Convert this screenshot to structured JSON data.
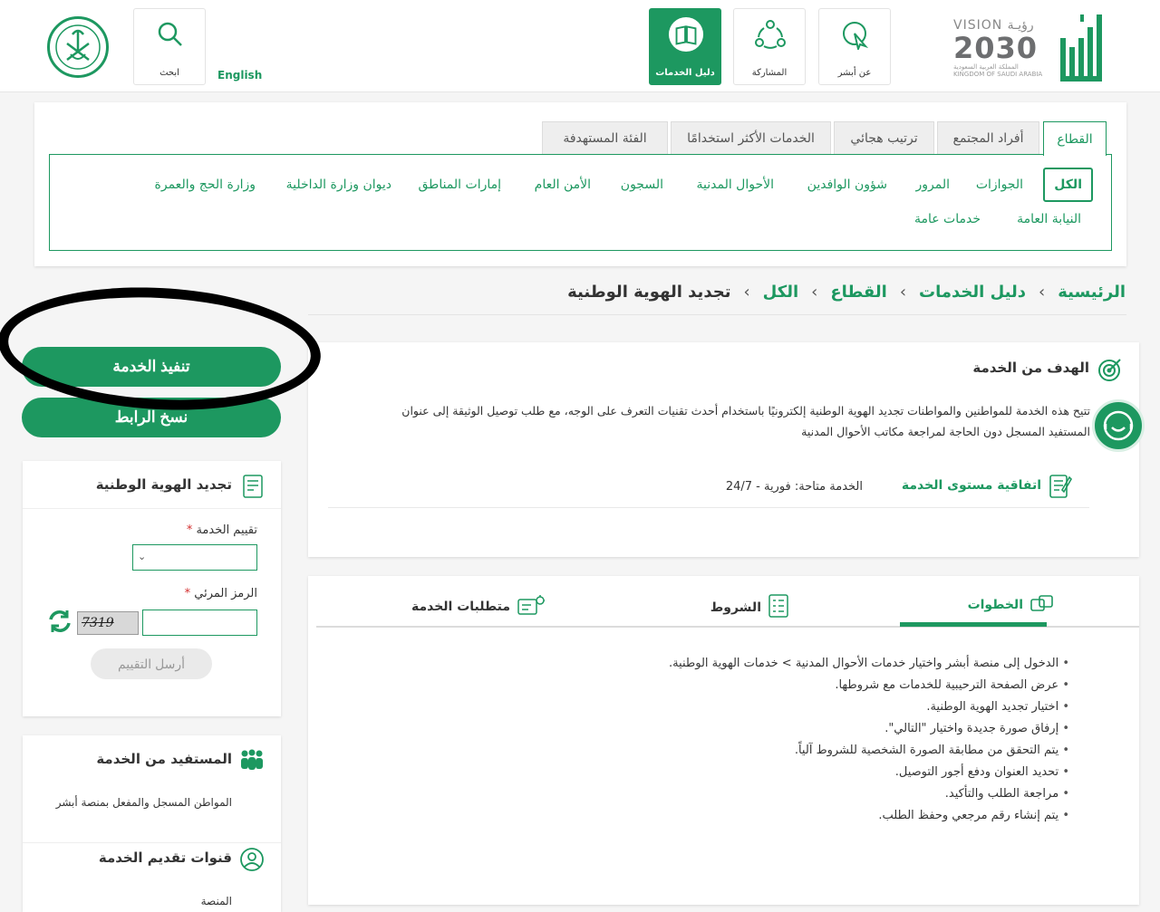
{
  "header": {
    "vision_line1": "VISION رؤيـة",
    "vision_year": "2030",
    "vision_country": "المملكة العربية السعودية KINGDOM OF SAUDI ARABIA",
    "nav": [
      {
        "label": "عن أبشر",
        "icon": "pointer-icon"
      },
      {
        "label": "المشاركة",
        "icon": "community-icon"
      },
      {
        "label": "دليل الخدمات",
        "icon": "book-icon"
      }
    ],
    "english_label": "English",
    "search_label": "ابحث"
  },
  "sector": {
    "tabs": [
      "القطاع",
      "أفراد المجتمع",
      "ترتيب هجائي",
      "الخدمات الأكثر استخدامًا",
      "الفئة المستهدفة"
    ],
    "filters_row1": [
      "الكل",
      "الجوازات",
      "المرور",
      "شؤون الوافدين",
      "الأحوال المدنية",
      "السجون",
      "الأمن العام",
      "إمارات المناطق",
      "ديوان وزارة الداخلية",
      "وزارة الحج والعمرة"
    ],
    "filters_row2": [
      "النيابة العامة",
      "خدمات عامة"
    ]
  },
  "breadcrumb": [
    "الرئيسية",
    "دليل الخدمات",
    "القطاع",
    "الكل",
    "تجديد الهوية الوطنية"
  ],
  "sidebar": {
    "execute_label": "تنفيذ الخدمة",
    "copy_link_label": "نسخ الرابط",
    "rating_card_title": "تجديد الهوية الوطنية",
    "rating_label": "تقييم الخدمة",
    "captcha_label": "الرمز المرئي",
    "required_mark": "*",
    "captcha_text": "7319",
    "send_rating_label": "أرسل التقييم",
    "beneficiary_title": "المستفيد من الخدمة",
    "beneficiary_text": "المواطن المسجل والمفعل بمنصة أبشر",
    "channels_title": "قنوات تقديم الخدمة",
    "channels_text": "المنصة"
  },
  "goal": {
    "title": "الهدف من الخدمة",
    "line1": "تتيح هذه الخدمة للمواطنين والمواطنات تجديد الهوية الوطنية إلكترونيًا باستخدام أحدث تقنيات التعرف على الوجه، مع طلب توصيل الوثيقة إلى عنوان",
    "line2": "المستفيد المسجل دون الحاجة لمراجعة مكاتب الأحوال المدنية",
    "sla_label": "اتفاقية مستوى الخدمة",
    "availability": "الخدمة متاحة: فورية - 24/7"
  },
  "details": {
    "tabs": [
      "الخطوات",
      "الشروط",
      "متطلبات الخدمة"
    ],
    "steps": [
      "الدخول إلى منصة أبشر واختيار خدمات الأحوال المدنية > خدمات الهوية الوطنية.",
      "عرض الصفحة الترحيبية للخدمات مع شروطها.",
      "اختيار تجديد الهوية الوطنية.",
      "إرفاق صورة جديدة واختيار \"التالي\".",
      "يتم التحقق من مطابقة الصورة الشخصية للشروط آلياً.",
      "تحديد العنوان ودفع أجور التوصيل.",
      "مراجعة الطلب والتأكيد.",
      "يتم إنشاء رقم مرجعي وحفظ الطلب."
    ]
  },
  "colors": {
    "brand_green": "#1d9860"
  }
}
